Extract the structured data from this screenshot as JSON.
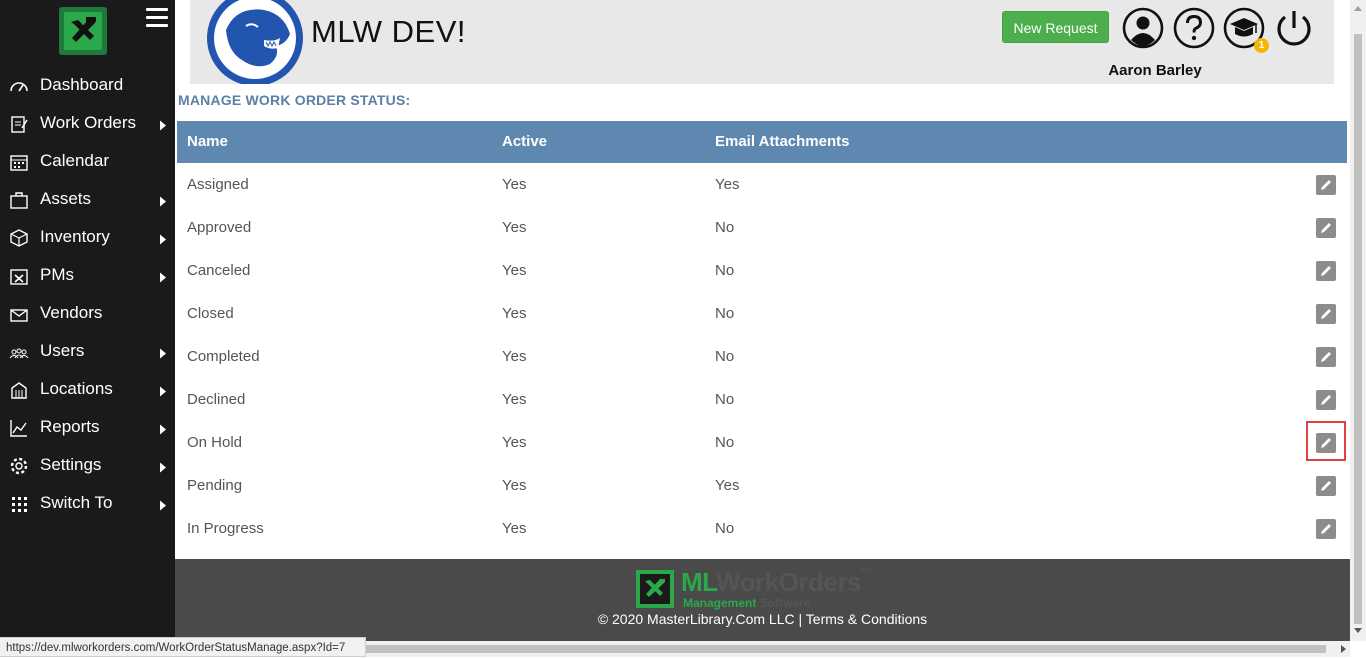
{
  "sidebar": {
    "items": [
      {
        "label": "Dashboard",
        "icon": "dashboard-icon",
        "has_submenu": false
      },
      {
        "label": "Work Orders",
        "icon": "work-orders-icon",
        "has_submenu": true
      },
      {
        "label": "Calendar",
        "icon": "calendar-icon",
        "has_submenu": false
      },
      {
        "label": "Assets",
        "icon": "assets-icon",
        "has_submenu": true
      },
      {
        "label": "Inventory",
        "icon": "inventory-icon",
        "has_submenu": true
      },
      {
        "label": "PMs",
        "icon": "pms-icon",
        "has_submenu": true
      },
      {
        "label": "Vendors",
        "icon": "vendors-icon",
        "has_submenu": false
      },
      {
        "label": "Users",
        "icon": "users-icon",
        "has_submenu": true
      },
      {
        "label": "Locations",
        "icon": "locations-icon",
        "has_submenu": true
      },
      {
        "label": "Reports",
        "icon": "reports-icon",
        "has_submenu": true
      },
      {
        "label": "Settings",
        "icon": "settings-icon",
        "has_submenu": true
      },
      {
        "label": "Switch To",
        "icon": "switch-to-icon",
        "has_submenu": true
      }
    ]
  },
  "header": {
    "site_title": "MLW DEV!",
    "new_request_label": "New Request",
    "user_name": "Aaron Barley",
    "notification_badge": "1"
  },
  "page": {
    "title": "MANAGE WORK ORDER STATUS:"
  },
  "table": {
    "columns": [
      "Name",
      "Active",
      "Email Attachments"
    ],
    "rows": [
      {
        "name": "Assigned",
        "active": "Yes",
        "email": "Yes"
      },
      {
        "name": "Approved",
        "active": "Yes",
        "email": "No"
      },
      {
        "name": "Canceled",
        "active": "Yes",
        "email": "No"
      },
      {
        "name": "Closed",
        "active": "Yes",
        "email": "No"
      },
      {
        "name": "Completed",
        "active": "Yes",
        "email": "No"
      },
      {
        "name": "Declined",
        "active": "Yes",
        "email": "No"
      },
      {
        "name": "On Hold",
        "active": "Yes",
        "email": "No"
      },
      {
        "name": "Pending",
        "active": "Yes",
        "email": "Yes"
      },
      {
        "name": "In Progress",
        "active": "Yes",
        "email": "No"
      }
    ]
  },
  "footer": {
    "logo_ml": "ML",
    "logo_work_orders": "WorkOrders",
    "logo_tm": "™",
    "logo_sub_management": "Management",
    "logo_sub_software": "Software",
    "copyright": "© 2020 MasterLibrary.Com LLC",
    "separator": "|",
    "terms_label": "Terms & Conditions"
  },
  "status_bar": {
    "url": "https://dev.mlworkorders.com/WorkOrderStatusManage.aspx?Id=7"
  },
  "colors": {
    "sidebar_bg": "#1a1a1a",
    "header_bg": "#e8e8e8",
    "table_header_bg": "#5f88b0",
    "page_title": "#5b7fa6",
    "new_request_green": "#4cae4c",
    "footer_bg": "#4a4a4a",
    "highlight_red": "#e04040",
    "brand_green": "#2ba84a"
  }
}
